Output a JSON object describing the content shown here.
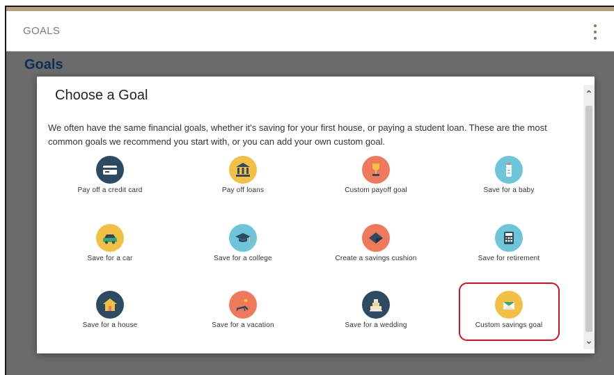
{
  "header": {
    "title": "GOALS"
  },
  "page": {
    "heading": "Goals"
  },
  "modal": {
    "title": "Choose a Goal",
    "description": "We often have the same financial goals, whether it's saving for your first house, or paying a student loan. These are the most common goals we recommend you start with, or you can add your own custom goal."
  },
  "colors": {
    "navy": "#2d4a63",
    "yellow": "#f2c045",
    "coral": "#ee7a5b",
    "lightblue": "#6ec4d8",
    "gold_bar": "#b2a27c",
    "highlight": "#d4131b"
  },
  "goals": [
    {
      "label": "Pay off a credit card",
      "icon": "credit-card-icon",
      "color": "#2d4a63"
    },
    {
      "label": "Pay off loans",
      "icon": "bank-icon",
      "color": "#f2c045"
    },
    {
      "label": "Custom payoff goal",
      "icon": "trophy-icon",
      "color": "#ee7a5b"
    },
    {
      "label": "Save for a baby",
      "icon": "baby-bottle-icon",
      "color": "#6ec4d8"
    },
    {
      "label": "Save for a car",
      "icon": "car-icon",
      "color": "#f2c045"
    },
    {
      "label": "Save for a college",
      "icon": "graduation-cap-icon",
      "color": "#6ec4d8"
    },
    {
      "label": "Create a savings cushion",
      "icon": "cushion-icon",
      "color": "#ee7a5b"
    },
    {
      "label": "Save for retirement",
      "icon": "calculator-icon",
      "color": "#6ec4d8"
    },
    {
      "label": "Save for a house",
      "icon": "house-icon",
      "color": "#2d4a63"
    },
    {
      "label": "Save for a vacation",
      "icon": "beach-chair-icon",
      "color": "#ee7a5b"
    },
    {
      "label": "Save for a wedding",
      "icon": "wedding-cake-icon",
      "color": "#2d4a63"
    },
    {
      "label": "Custom savings goal",
      "icon": "envelope-icon",
      "color": "#f2c045",
      "highlighted": true
    }
  ]
}
